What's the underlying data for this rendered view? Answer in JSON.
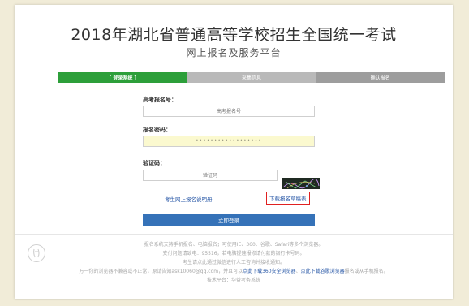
{
  "header": {
    "title": "2018年湖北省普通高等学校招生全国统一考试",
    "subtitle": "网上报名及服务平台"
  },
  "steps": [
    {
      "label": "[ 登录系统 ]",
      "active": true
    },
    {
      "label": "采集信息",
      "active": false
    },
    {
      "label": "确认报名",
      "active": false
    }
  ],
  "form": {
    "exam_no_label": "高考报名号：",
    "exam_no_placeholder": "高考报名号",
    "password_label": "报名密码：",
    "password_value": "••••••••••••••••••",
    "captcha_label": "验证码：",
    "captcha_placeholder": "验证码",
    "guide_link": "考生网上报名说明册",
    "download_link": "下载报名草稿表",
    "login_button": "立即登录"
  },
  "footer": {
    "line1": "报名系统支持手机报名、电脑报名；可使用IE、360、谷歌、Safari等多个浏览器。",
    "line2": "支付问题请致电：95516，若电脑提速报修请付款的银行卡号码。",
    "line3": "考生请点此通过微信进行人工咨询并接收通知。",
    "line4_pre": "万一你的浏览器不兼容或不正常，原请告知ask10060@qq.com，并且可以",
    "line4_link1": "点此下载360安全浏览器",
    "line4_sep": "、",
    "line4_link2": "点此下载谷歌浏览器",
    "line4_post": "报名或从手机报名。",
    "line5": "技术平台：华益考务系统"
  },
  "colors": {
    "active_step": "#2d9f3a",
    "login_button": "#3572b8",
    "highlight_border": "#e02020",
    "link": "#2b5aa8"
  }
}
